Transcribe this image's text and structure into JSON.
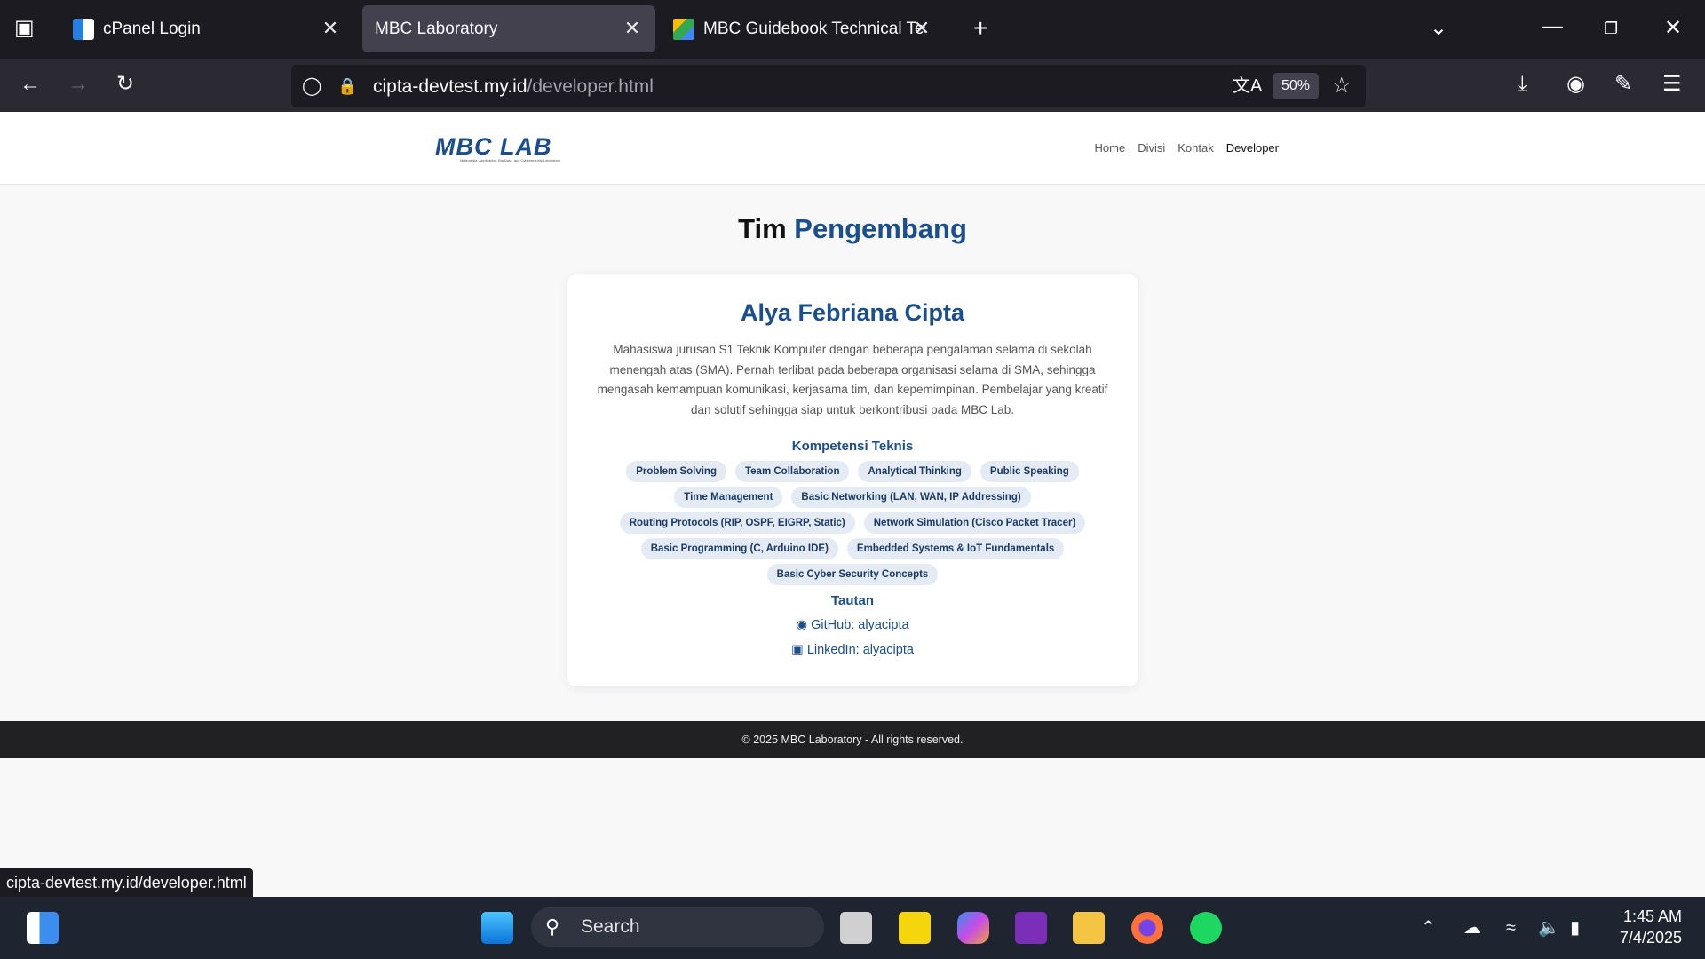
{
  "browser": {
    "tabs": [
      {
        "title": "cPanel Login"
      },
      {
        "title": "MBC Laboratory"
      },
      {
        "title": "MBC Guidebook Technical Test"
      }
    ],
    "url_host": "cipta-devtest.my.id",
    "url_path": "/developer.html",
    "zoom": "50%",
    "status_url": "cipta-devtest.my.id/developer.html"
  },
  "site": {
    "logo_text": "MBC LAB",
    "logo_subtitle": "Multimedia, Application, Big Data, and Cybersecurity Laboratory",
    "menu": [
      "Home",
      "Divisi",
      "Kontak",
      "Developer"
    ],
    "page_title_1": "Tim",
    "page_title_2": "Pengembang",
    "profile": {
      "name": "Alya Febriana Cipta",
      "bio": "Mahasiswa jurusan S1 Teknik Komputer dengan beberapa pengalaman selama di sekolah menengah atas (SMA). Pernah terlibat pada beberapa organisasi selama di SMA, sehingga mengasah kemampuan komunikasi, kerjasama tim, dan kepemimpinan. Pembelajar yang kreatif dan solutif sehingga siap untuk berkontribusi pada MBC Lab.",
      "skills_heading": "Kompetensi Teknis",
      "skills": [
        "Problem Solving",
        "Team Collaboration",
        "Analytical Thinking",
        "Public Speaking",
        "Time Management",
        "Basic Networking (LAN, WAN, IP Addressing)",
        "Routing Protocols (RIP, OSPF, EIGRP, Static)",
        "Network Simulation (Cisco Packet Tracer)",
        "Basic Programming (C, Arduino IDE)",
        "Embedded Systems & IoT Fundamentals",
        "Basic Cyber Security Concepts"
      ],
      "links_heading": "Tautan",
      "github": "GitHub: alyacipta",
      "linkedin": "LinkedIn: alyacipta"
    },
    "footer": "© 2025 MBC Laboratory - All rights reserved."
  },
  "taskbar": {
    "search_placeholder": "Search",
    "time": "1:45 AM",
    "date": "7/4/2025"
  }
}
